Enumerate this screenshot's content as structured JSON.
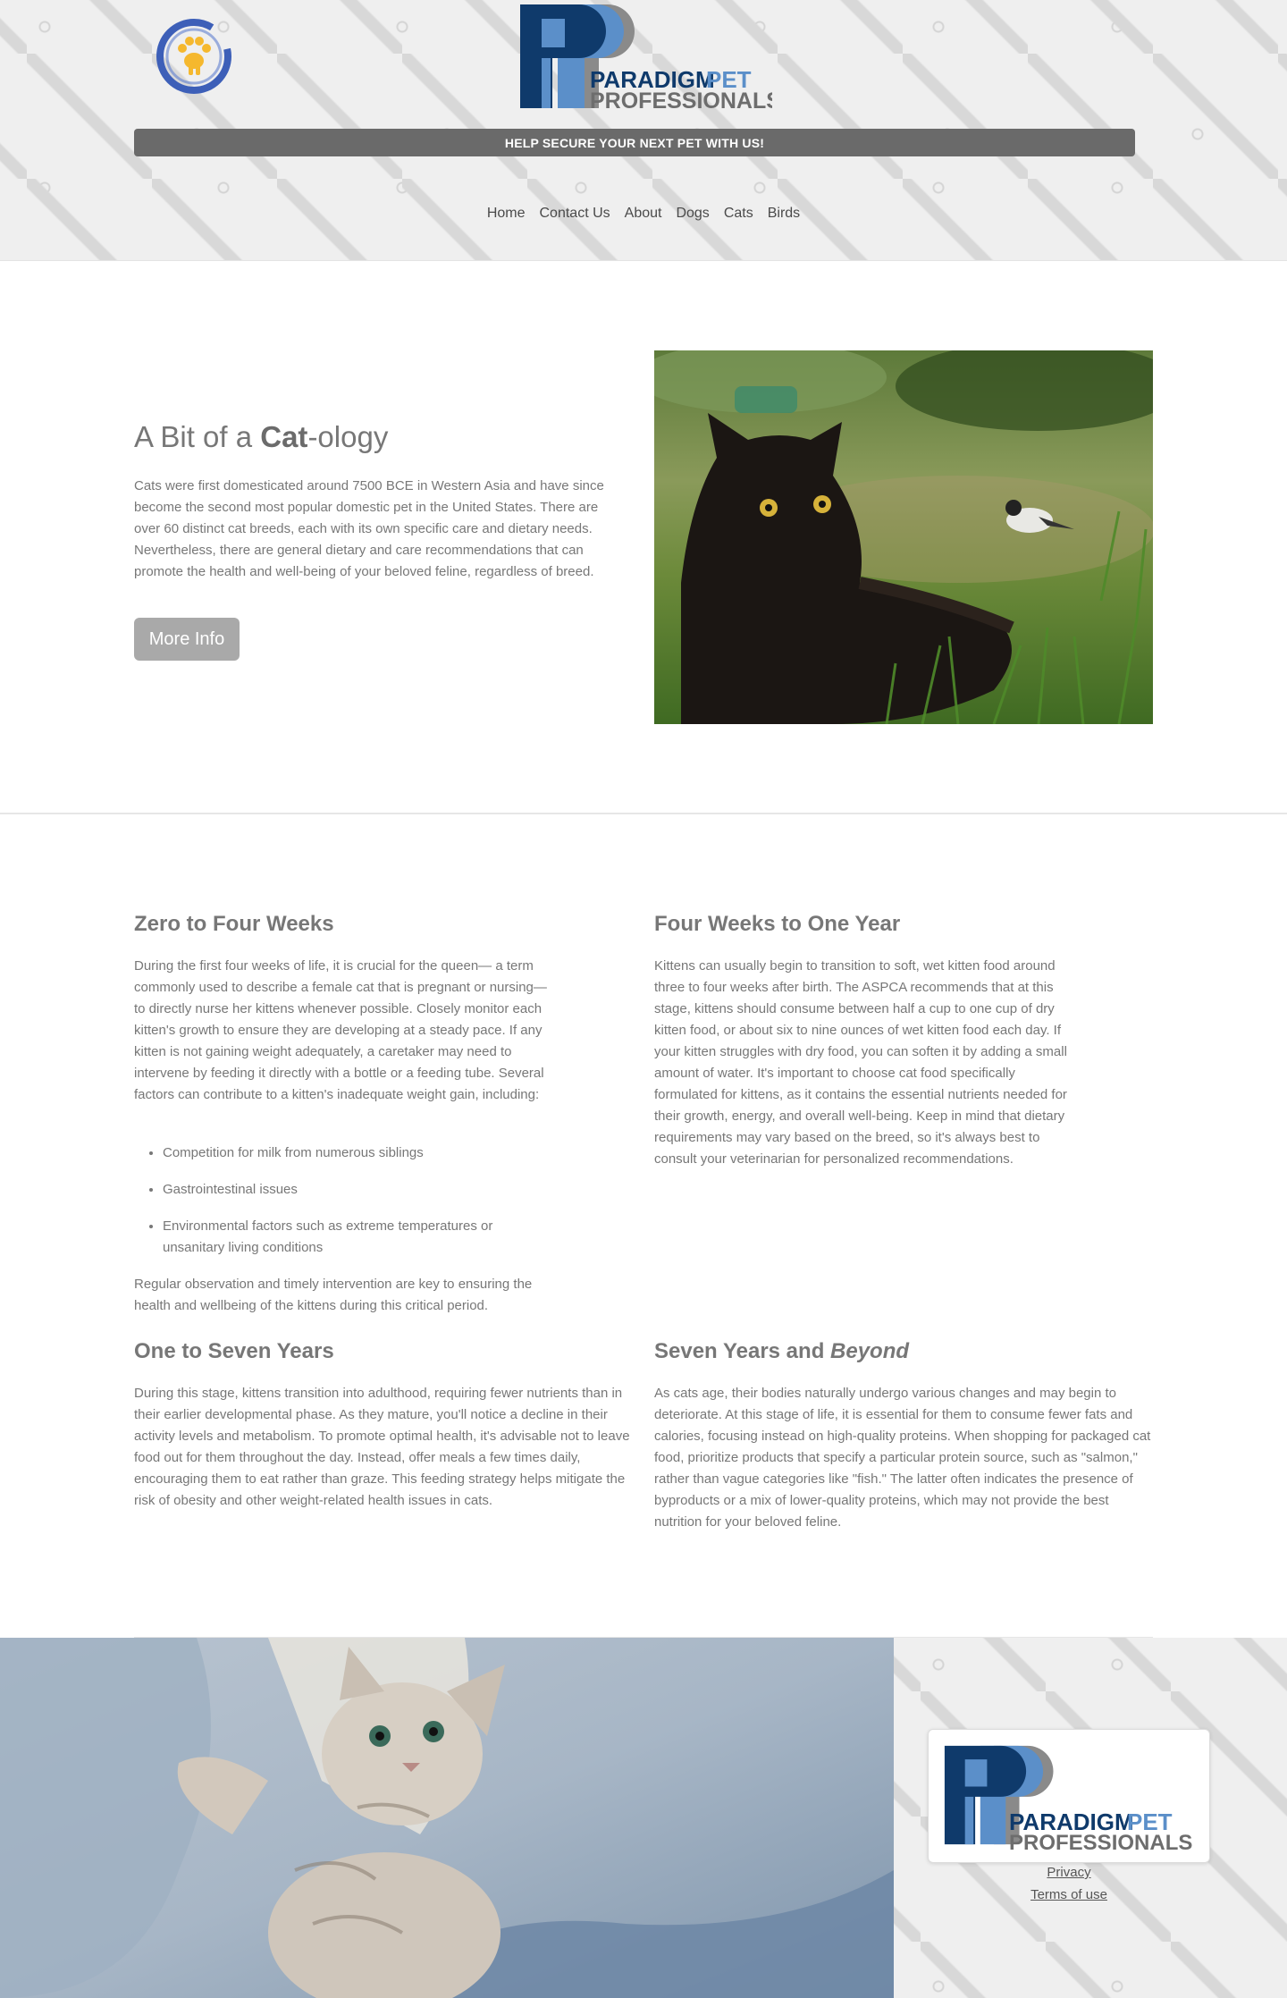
{
  "header": {
    "brand_line1": "PARADIGM",
    "brand_line1b": "PET",
    "brand_line2": "PROFESSIONALS",
    "banner": "HELP SECURE YOUR NEXT PET WITH US!",
    "nav": [
      "Home",
      "Contact Us",
      "About",
      "Dogs",
      "Cats",
      "Birds"
    ]
  },
  "intro": {
    "title_pre": "A Bit of a ",
    "title_bold": "Cat",
    "title_post": "-ology",
    "text": "Cats were first domesticated around 7500 BCE in Western Asia and have since become the second most popular domestic pet in the United States. There are over 60 distinct cat breeds, each with its own specific care and dietary needs. Nevertheless, there are general dietary and care recommendations that can promote the health and well-being of your beloved feline, regardless of breed.",
    "button": "More Info"
  },
  "sections": {
    "s1": {
      "title": "Zero to Four Weeks",
      "text": "During the first four weeks of life, it is crucial for the queen— a term commonly used to describe a female cat that is pregnant or nursing—to directly nurse her kittens whenever possible. Closely monitor each kitten's growth to ensure they are developing at a steady pace. If any kitten is not gaining weight adequately, a caretaker may need to intervene by feeding it directly with a bottle or a feeding tube. Several factors can contribute to a kitten's inadequate weight gain, including:",
      "items": [
        "Competition for milk from numerous siblings",
        "Gastrointestinal issues",
        "Environmental factors such as extreme temperatures or unsanitary living conditions"
      ],
      "closing": "Regular observation and timely intervention are key to ensuring the health and wellbeing of the kittens during this critical period."
    },
    "s2": {
      "title": "Four Weeks to One Year",
      "text": "Kittens can usually begin to transition to soft, wet kitten food around three to four weeks after birth. The ASPCA recommends that at this stage, kittens should consume between half a cup to one cup of dry kitten food, or about six to nine ounces of wet kitten food each day. If your kitten struggles with dry food, you can soften it by adding a small amount of water. It's important to choose cat food specifically formulated for kittens, as it contains the essential nutrients needed for their growth, energy, and overall well-being. Keep in mind that dietary requirements may vary based on the breed, so it's always best to consult your veterinarian for personalized recommendations."
    },
    "s3": {
      "title": "One to Seven Years",
      "text": "During this stage, kittens transition into adulthood, requiring fewer nutrients than in their earlier developmental phase. As they mature, you'll notice a decline in their activity levels and metabolism. To promote optimal health, it's advisable not to leave food out for them throughout the day. Instead, offer meals a few times daily, encouraging them to eat rather than graze. This feeding strategy helps mitigate the risk of obesity and other weight-related health issues in cats."
    },
    "s4": {
      "title_pre": "Seven Years and ",
      "title_em": "Beyond",
      "text": "As cats age, their bodies naturally undergo various changes and may begin to deteriorate. At this stage of life, it is essential for them to consume fewer fats and calories, focusing instead on high-quality proteins. When shopping for packaged cat food, prioritize products that specify a particular protein source, such as \"salmon,\" rather than vague categories like \"fish.\" The latter often indicates the presence of byproducts or a mix of lower-quality proteins, which may not provide the best nutrition for your beloved feline."
    }
  },
  "footer": {
    "brand_line1": "PARADIGM",
    "brand_line1b": "PET",
    "brand_line2": "PROFESSIONALS",
    "privacy": "Privacy",
    "terms": "Terms of use"
  },
  "colors": {
    "brand_dark": "#0f3a6b",
    "brand_light": "#5b8fc9",
    "banner": "#6a6a6a",
    "badge_blue": "#3d5fb8",
    "badge_yellow": "#f5b82e"
  }
}
